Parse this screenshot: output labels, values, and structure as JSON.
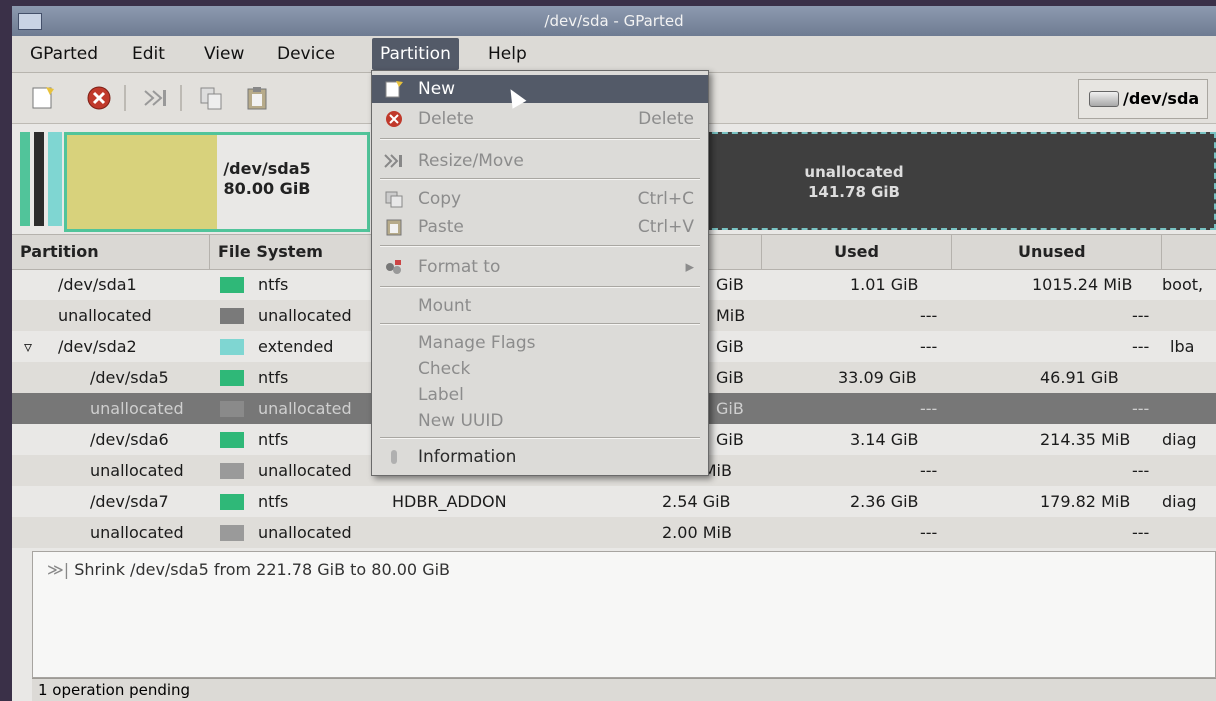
{
  "window": {
    "title": "/dev/sda - GParted"
  },
  "menubar": [
    {
      "label": "GParted"
    },
    {
      "label": "Edit"
    },
    {
      "label": "View"
    },
    {
      "label": "Device"
    },
    {
      "label": "Partition"
    },
    {
      "label": "Help"
    }
  ],
  "toolbar": {
    "device": "/dev/sda"
  },
  "diskmap": {
    "sda5_name": "/dev/sda5",
    "sda5_size": "80.00 GiB",
    "unalloc_name": "unallocated",
    "unalloc_size": "141.78 GiB"
  },
  "table": {
    "headers": [
      "Partition",
      "File System",
      "",
      "",
      "Used",
      "Unused"
    ],
    "rows": [
      {
        "partition": "/dev/sda1",
        "fs": "ntfs",
        "label": "",
        "size": "GiB",
        "used": "1.01 GiB",
        "unused": "1015.24 MiB",
        "flags": "boot,",
        "fscolor": "#2fb878"
      },
      {
        "partition": "unallocated",
        "fs": "unallocated",
        "label": "",
        "size": "MiB",
        "used": "---",
        "unused": "---",
        "flags": "",
        "fscolor": "#7a7a7a"
      },
      {
        "partition": "/dev/sda2",
        "fs": "extended",
        "label": "",
        "size": "GiB",
        "used": "---",
        "unused": "---",
        "flags": "lba",
        "fscolor": "#7fd6d2"
      },
      {
        "partition": "/dev/sda5",
        "fs": "ntfs",
        "label": "",
        "size": "GiB",
        "used": "33.09 GiB",
        "unused": "46.91 GiB",
        "flags": "",
        "fscolor": "#2fb878"
      },
      {
        "partition": "unallocated",
        "fs": "unallocated",
        "label": "",
        "size": "GiB",
        "used": "---",
        "unused": "---",
        "flags": "",
        "fscolor": "#8a8a8a"
      },
      {
        "partition": "/dev/sda6",
        "fs": "ntfs",
        "label": "",
        "size": "GiB",
        "used": "3.14 GiB",
        "unused": "214.35 MiB",
        "flags": "diag",
        "fscolor": "#2fb878"
      },
      {
        "partition": "unallocated",
        "fs": "unallocated",
        "label": "",
        "size": "2.00 MiB",
        "used": "---",
        "unused": "---",
        "flags": "",
        "fscolor": "#9a9a9a"
      },
      {
        "partition": "/dev/sda7",
        "fs": "ntfs",
        "label": "HDBR_ADDON",
        "size": "2.54 GiB",
        "used": "2.36 GiB",
        "unused": "179.82 MiB",
        "flags": "diag",
        "fscolor": "#2fb878"
      },
      {
        "partition": "unallocated",
        "fs": "unallocated",
        "label": "",
        "size": "2.00 MiB",
        "used": "---",
        "unused": "---",
        "flags": "",
        "fscolor": "#9a9a9a"
      }
    ]
  },
  "partition_menu": {
    "new": "New",
    "delete": "Delete",
    "delete_acc": "Delete",
    "resize": "Resize/Move",
    "copy": "Copy",
    "copy_acc": "Ctrl+C",
    "paste": "Paste",
    "paste_acc": "Ctrl+V",
    "format": "Format to",
    "mount": "Mount",
    "flags": "Manage Flags",
    "check": "Check",
    "label": "Label",
    "uuid": "New UUID",
    "info": "Information"
  },
  "operations": {
    "item": "Shrink /dev/sda5 from 221.78 GiB to 80.00 GiB"
  },
  "status": {
    "text": "1 operation pending"
  }
}
